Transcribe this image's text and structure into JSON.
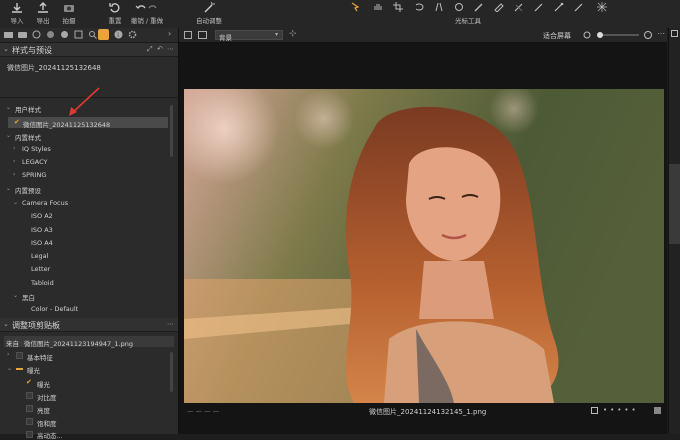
{
  "toolbar": {
    "import": "导入",
    "export": "导出",
    "capture": "拍摄",
    "reset": "重置",
    "undo_redo": "撤销 / 重做",
    "auto_adjust": "自动调整",
    "cursor_tools": "光标工具"
  },
  "styles_panel": {
    "title": "样式与预设",
    "current_style": "微信图片_20241125132648",
    "tree": {
      "user_styles": "用户样式",
      "user_style_item": "微信图片_20241125132648",
      "builtin_styles": "内置样式",
      "iq_styles": "IQ Styles",
      "legacy": "LEGACY",
      "spring": "SPRING",
      "builtin_presets": "内置预设",
      "camera_focus": "Camera Focus",
      "iso_a2": "ISO A2",
      "iso_a3": "ISO A3",
      "iso_a4": "ISO A4",
      "legal": "Legal",
      "letter": "Letter",
      "tabloid": "Tabloid",
      "bw": "黑白",
      "color_default": "Color - Default"
    }
  },
  "clipboard_panel": {
    "title": "调整项剪贴板",
    "source_label": "来自",
    "source_file": "微信图片_20241123194947_1.png",
    "items": {
      "basic": "基本特征",
      "exposure_group": "曝光",
      "exposure": "曝光",
      "contrast": "对比度",
      "brightness": "亮度",
      "saturation": "饱和度",
      "more": "高动态..."
    }
  },
  "viewer": {
    "background_select": "背景",
    "fit_label": "适合屏幕",
    "filename": "微信图片_20241124132145_1.png",
    "nav_dashes": "—   —   —   —"
  },
  "colors": {
    "accent": "#e8a33a",
    "annotation_arrow": "#e03a2f",
    "selected_row": "#4a4a4a"
  }
}
